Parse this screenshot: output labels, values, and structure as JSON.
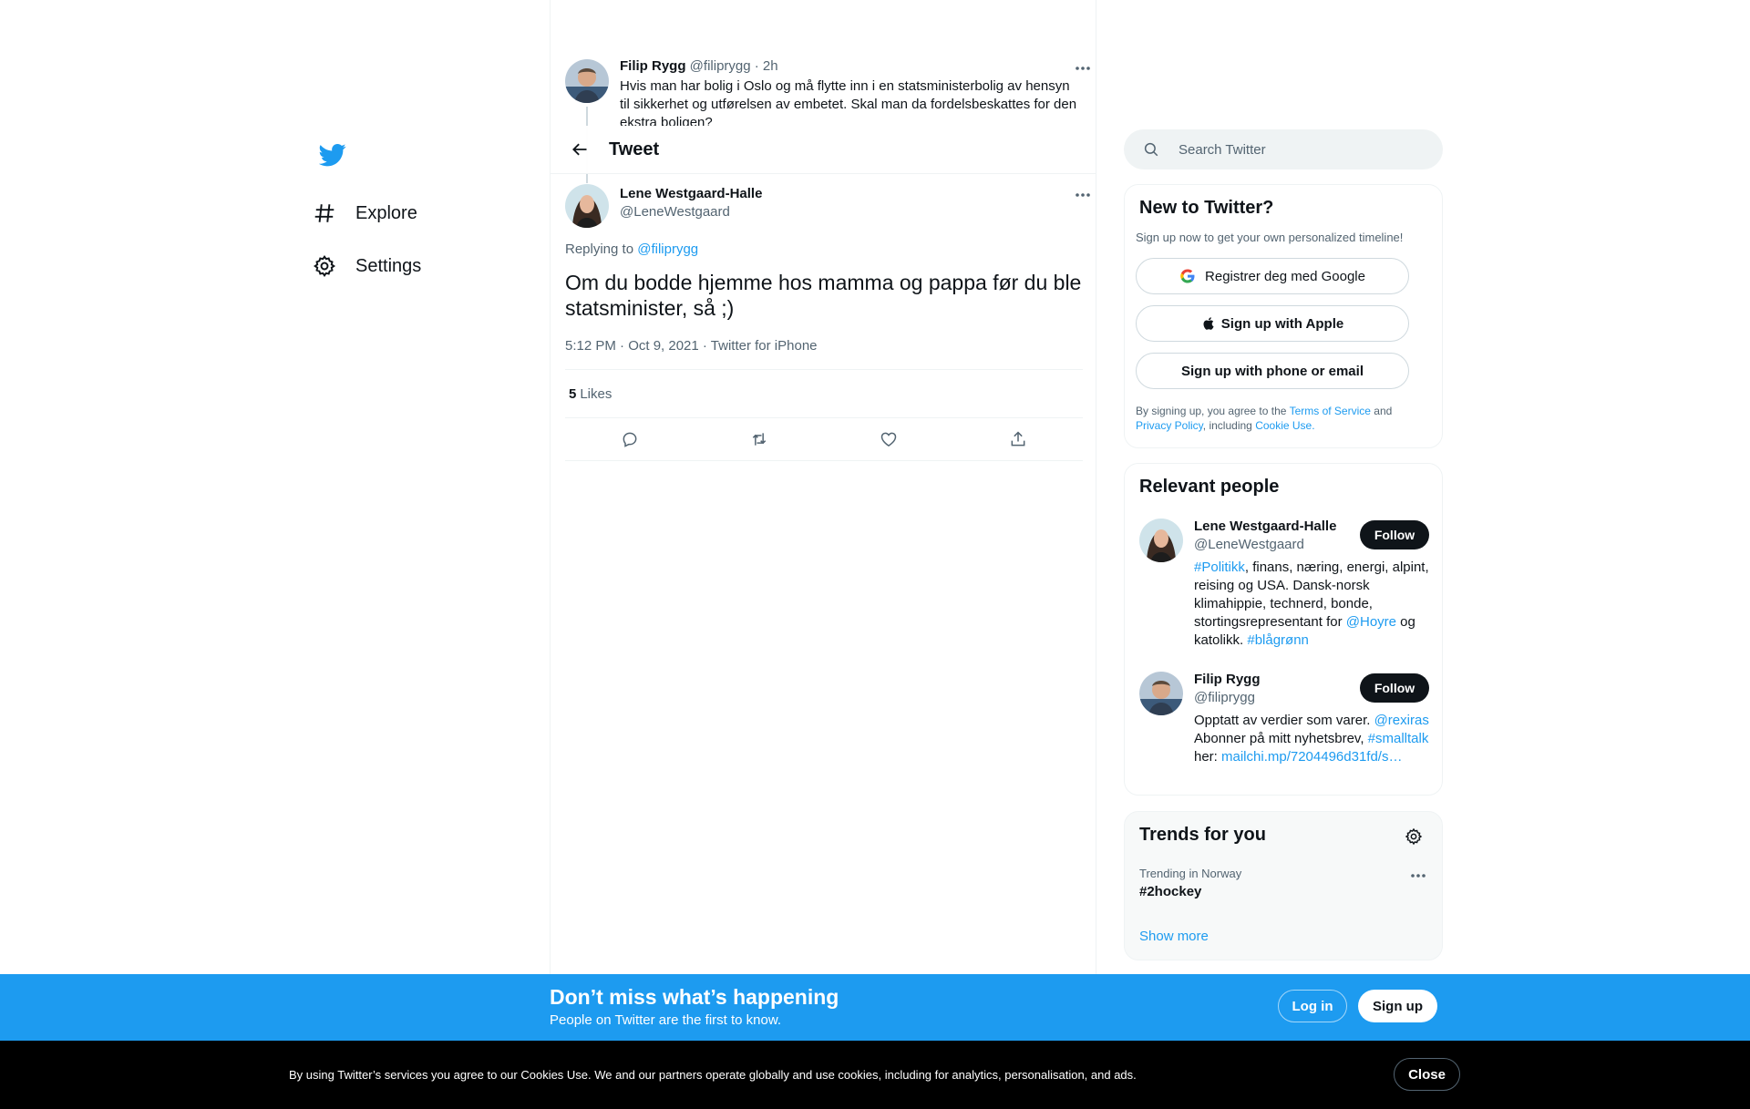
{
  "nav": {
    "logo_icon": "twitter-bird-icon",
    "brand_color": "#1d9bf0",
    "items": [
      {
        "icon": "hashtag-icon",
        "label": "Explore"
      },
      {
        "icon": "gear-icon",
        "label": "Settings"
      }
    ]
  },
  "header": {
    "title": "Tweet"
  },
  "parent_tweet": {
    "name": "Filip Rygg",
    "handle": "@filiprygg",
    "time": "· 2h",
    "text": "Hvis man har bolig i Oslo og må flytte inn i en statsministerbolig av hensyn til sikkerhet og utførelsen av embetet. Skal man da fordelsbeskattes for den ekstra boligen?"
  },
  "tweet": {
    "name": "Lene Westgaard-Halle",
    "handle": "@LeneWestgaard",
    "replying_prefix": "Replying to",
    "replying_to": "@filiprygg",
    "text": "Om du bodde hjemme hos mamma og pappa før du ble statsminister, så ;)",
    "meta": "5:12 PM · Oct 9, 2021 · Twitter for iPhone",
    "likes_count": "5",
    "likes_label": "Likes",
    "actions": [
      "reply-icon",
      "retweet-icon",
      "like-icon",
      "share-icon"
    ]
  },
  "search": {
    "placeholder": "Search Twitter"
  },
  "signup_card": {
    "title": "New to Twitter?",
    "subtitle": "Sign up now to get your own personalized timeline!",
    "google_label": "Registrer deg med Google",
    "apple_label": "Sign up with Apple",
    "phone_label": "Sign up with phone or email",
    "legal_prefix": "By signing up, you agree to the",
    "terms": "Terms of Service",
    "and": "and",
    "privacy": "Privacy Policy",
    "including": ", including",
    "cookie": "Cookie Use."
  },
  "people_card": {
    "title": "Relevant people",
    "people": [
      {
        "name": "Lene Westgaard-Halle",
        "handle": "@LeneWestgaard",
        "follow": "Follow",
        "bio": [
          {
            "t": "#Politikk",
            "link": true
          },
          {
            "t": ", finans, næring, energi, alpint, reising og USA. Dansk-norsk klimahippie, technerd, bonde, stortingsrepresentant for ",
            "link": false
          },
          {
            "t": "@Hoyre",
            "link": true
          },
          {
            "t": " og katolikk. ",
            "link": false
          },
          {
            "t": "#blågrønn",
            "link": true
          }
        ]
      },
      {
        "name": "Filip Rygg",
        "handle": "@filiprygg",
        "follow": "Follow",
        "bio": [
          {
            "t": "Opptatt av verdier som varer. ",
            "link": false
          },
          {
            "t": "@rexiras",
            "link": true
          },
          {
            "t": " Abonner på mitt nyhetsbrev, ",
            "link": false
          },
          {
            "t": "#smalltalk",
            "link": true
          },
          {
            "t": " her: ",
            "link": false
          },
          {
            "t": "mailchi.mp/7204496d31fd/s…",
            "link": true
          }
        ]
      }
    ]
  },
  "trends_card": {
    "title": "Trends for you",
    "context": "Trending in Norway",
    "trend": "#2hockey",
    "show_more": "Show more"
  },
  "banner": {
    "title": "Don’t miss what’s happening",
    "subtitle": "People on Twitter are the first to know.",
    "login": "Log in",
    "signup": "Sign up"
  },
  "cookie_bar": {
    "text": "By using Twitter’s services you agree to our Cookies Use. We and our partners operate globally and use cookies, including for analytics, personalisation, and ads.",
    "close": "Close"
  }
}
